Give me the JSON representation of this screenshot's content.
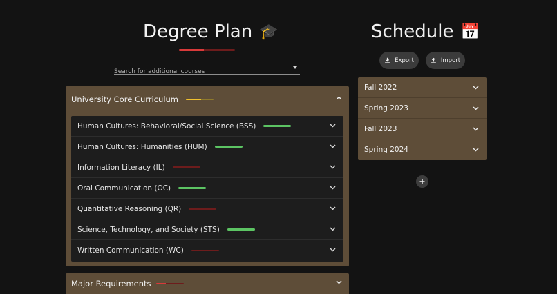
{
  "degree_plan": {
    "title": "Degree Plan",
    "emoji": "🎓",
    "progress": 0.45,
    "colors": {
      "track": "#6d1c1c",
      "fill": "#d83a3a"
    }
  },
  "search": {
    "placeholder": "Search for additional courses"
  },
  "core_curriculum": {
    "title": "University Core Curriculum",
    "expanded": true,
    "progress": 0.55,
    "progress_colors": {
      "track": "#8f7a2c",
      "fill": "#f2c12e"
    },
    "items": [
      {
        "label": "Human Cultures: Behavioral/Social Science (BSS)",
        "progress": 1.0,
        "color": "#5cc463",
        "track": "#2d5a2f"
      },
      {
        "label": "Human Cultures: Humanities (HUM)",
        "progress": 1.0,
        "color": "#5cc463",
        "track": "#2d5a2f"
      },
      {
        "label": "Information Literacy (IL)",
        "progress": 0.0,
        "color": "#d83a3a",
        "track": "#6d1c1c"
      },
      {
        "label": "Oral Communication (OC)",
        "progress": 1.0,
        "color": "#5cc463",
        "track": "#2d5a2f"
      },
      {
        "label": "Quantitative Reasoning (QR)",
        "progress": 0.0,
        "color": "#d83a3a",
        "track": "#6d1c1c"
      },
      {
        "label": "Science, Technology, and Society (STS)",
        "progress": 1.0,
        "color": "#5cc463",
        "track": "#2d5a2f"
      },
      {
        "label": "Written Communication (WC)",
        "progress": 0.0,
        "color": "#d83a3a",
        "track": "#6d1c1c"
      }
    ]
  },
  "major_requirements": {
    "title": "Major Requirements",
    "expanded": false,
    "progress": 0.35,
    "progress_colors": {
      "track": "#6d1c1c",
      "fill": "#d83a3a"
    }
  },
  "schedule": {
    "title": "Schedule",
    "emoji": "📅",
    "export_label": "Export",
    "import_label": "Import",
    "semesters": [
      {
        "label": "Fall 2022"
      },
      {
        "label": "Spring 2023"
      },
      {
        "label": "Fall 2023"
      },
      {
        "label": "Spring 2024"
      }
    ]
  },
  "icons": {
    "expand": "chevron-down-icon",
    "collapse": "chevron-up-icon",
    "export": "download-icon",
    "import": "upload-icon",
    "add": "plus-icon",
    "dropdown": "caret-down-icon"
  }
}
